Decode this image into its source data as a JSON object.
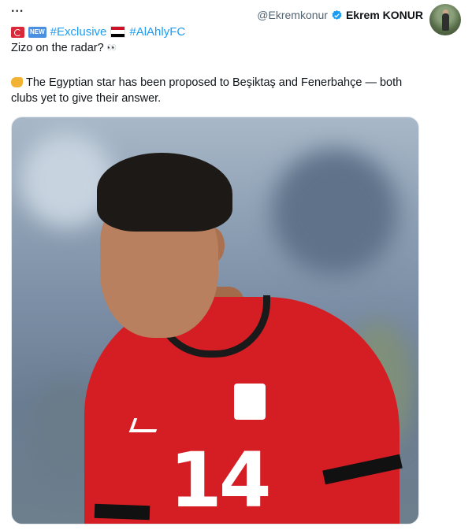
{
  "menu_dots": "...",
  "author": {
    "handle": "@Ekremkonur",
    "name": "Ekrem KONUR"
  },
  "tags": {
    "new_badge": "NEW",
    "hashtag1": "#Exclusive",
    "hashtag2": "#AlAhlyFC"
  },
  "tweet": {
    "line1": "Zizo on the radar?",
    "line1_emoji": "👀",
    "body": "The Egyptian star has been proposed to Beşiktaş and Fenerbahçe — both clubs yet to give their answer."
  },
  "photo": {
    "jersey_number": "14"
  },
  "colors": {
    "hashtag": "#1d9bf0",
    "verified": "#1d9bf0",
    "jersey": "#d51e23"
  },
  "icons": [
    "more-icon",
    "verified-icon",
    "turkey-flag-icon",
    "new-badge-icon",
    "egypt-flag-icon",
    "eyes-icon",
    "pointing-hand-icon"
  ]
}
